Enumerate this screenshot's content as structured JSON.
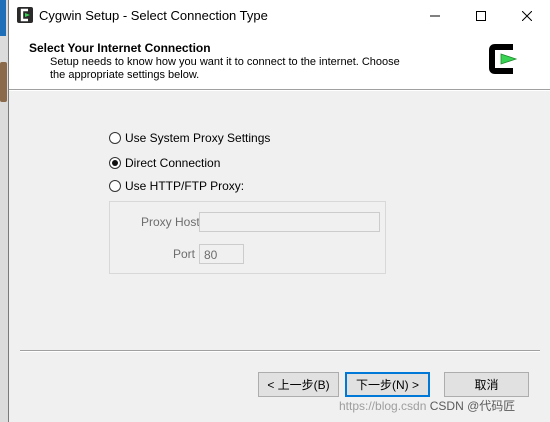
{
  "window": {
    "title": "Cygwin Setup - Select Connection Type"
  },
  "header": {
    "title": "Select Your Internet Connection",
    "description": "Setup needs to know how you want it to connect to the internet.  Choose the appropriate settings below."
  },
  "options": [
    {
      "label": "Use System Proxy Settings",
      "checked": false
    },
    {
      "label": "Direct Connection",
      "checked": true
    },
    {
      "label": "Use HTTP/FTP Proxy:",
      "checked": false
    }
  ],
  "proxy": {
    "host_label": "Proxy Host",
    "host_value": "",
    "port_label": "Port",
    "port_value": "80"
  },
  "buttons": {
    "back": "< 上一步(B)",
    "next": "下一步(N) >",
    "cancel": "取消"
  },
  "watermark": {
    "url": "https://blog.csdn",
    "credit": "CSDN @代码匠"
  },
  "colors": {
    "focus_border": "#0078d7",
    "logo_green": "#39d353"
  }
}
